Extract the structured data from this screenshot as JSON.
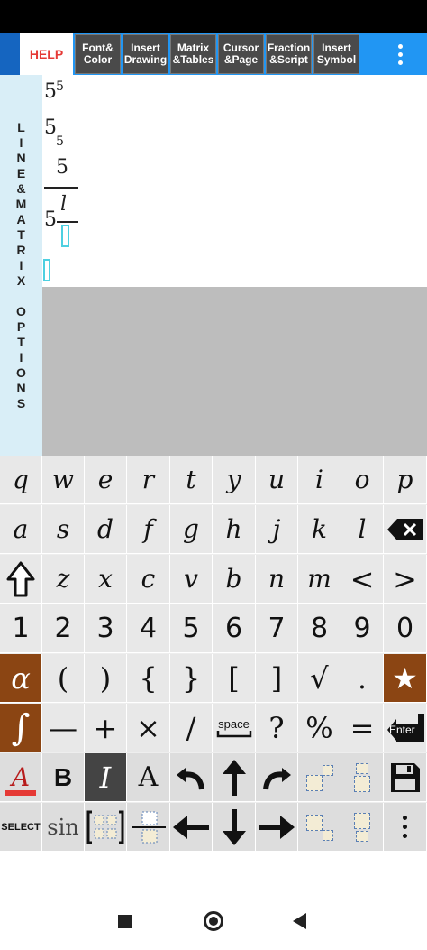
{
  "toolbar": {
    "help": "HELP",
    "buttons": [
      {
        "l1": "Font&",
        "l2": "Color"
      },
      {
        "l1": "Insert",
        "l2": "Drawing"
      },
      {
        "l1": "Matrix",
        "l2": "&Tables"
      },
      {
        "l1": "Cursor",
        "l2": "&Page"
      },
      {
        "l1": "Fraction",
        "l2": "&Script"
      },
      {
        "l1": "Insert",
        "l2": "Symbol"
      }
    ],
    "more_icon": "vertical-dots-icon"
  },
  "sidebar": {
    "label": "LINE&MATRIX OPTIONS"
  },
  "editor": {
    "line1_base": "5",
    "line1_sup": "5",
    "line2_base": "5",
    "line2_sub": "5",
    "frac_num": "5",
    "line4_base": "5",
    "line4_num": "l"
  },
  "keyboard": {
    "row1": [
      "q",
      "w",
      "e",
      "r",
      "t",
      "y",
      "u",
      "i",
      "o",
      "p"
    ],
    "row2": [
      "a",
      "s",
      "d",
      "f",
      "g",
      "h",
      "j",
      "k",
      "l"
    ],
    "row3": [
      "z",
      "x",
      "c",
      "v",
      "b",
      "n",
      "m",
      "<",
      ">"
    ],
    "row4": [
      "1",
      "2",
      "3",
      "4",
      "5",
      "6",
      "7",
      "8",
      "9",
      "0"
    ],
    "row5": [
      "α",
      "(",
      ")",
      "{",
      "}",
      "[",
      "]",
      "√",
      ".",
      "★"
    ],
    "row6": [
      "∫",
      "—",
      "+",
      "×",
      "/",
      "space",
      "?",
      "%",
      "="
    ],
    "enter": "Enter",
    "select": "SELECT",
    "sin": "sin",
    "bold": "B",
    "italic": "I",
    "font_a": "A"
  },
  "colors": {
    "accent": "#2196f3",
    "brown": "#8b4513",
    "help_red": "#e53935"
  }
}
